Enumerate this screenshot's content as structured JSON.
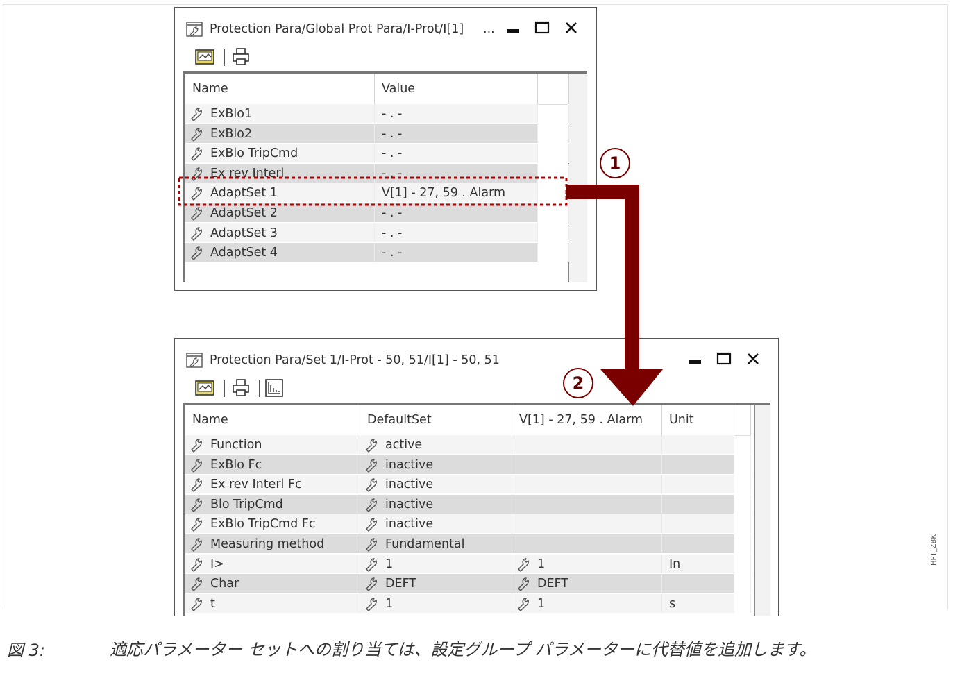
{
  "window1": {
    "title": "Protection Para/Global Prot Para/I-Prot/I[1]",
    "ellipsis": "...",
    "columns": [
      "Name",
      "Value"
    ],
    "rows": [
      {
        "name": "ExBlo1",
        "value": "- . -"
      },
      {
        "name": "ExBlo2",
        "value": "- . -"
      },
      {
        "name": "ExBlo TripCmd",
        "value": "- . -"
      },
      {
        "name": "Ex rev Interl",
        "value": "- . -"
      },
      {
        "name": "AdaptSet 1",
        "value": "V[1] - 27, 59 . Alarm"
      },
      {
        "name": "AdaptSet 2",
        "value": "- . -"
      },
      {
        "name": "AdaptSet 3",
        "value": "- . -"
      },
      {
        "name": "AdaptSet 4",
        "value": "- . -"
      }
    ]
  },
  "window2": {
    "title": "Protection Para/Set 1/I-Prot - 50, 51/I[1] - 50, 51",
    "columns": [
      "Name",
      "DefaultSet",
      "V[1] - 27, 59 . Alarm",
      "Unit"
    ],
    "rows": [
      {
        "name": "Function",
        "default": "active",
        "adapt": "",
        "unit": ""
      },
      {
        "name": "ExBlo Fc",
        "default": "inactive",
        "adapt": "",
        "unit": ""
      },
      {
        "name": "Ex rev Interl Fc",
        "default": "inactive",
        "adapt": "",
        "unit": ""
      },
      {
        "name": "Blo TripCmd",
        "default": "inactive",
        "adapt": "",
        "unit": ""
      },
      {
        "name": "ExBlo TripCmd Fc",
        "default": "inactive",
        "adapt": "",
        "unit": ""
      },
      {
        "name": "Measuring method",
        "default": "Fundamental",
        "adapt": "",
        "unit": ""
      },
      {
        "name": "I>",
        "default": "1",
        "adapt": "1",
        "unit": "In"
      },
      {
        "name": "Char",
        "default": "DEFT",
        "adapt": "DEFT",
        "unit": ""
      },
      {
        "name": "t",
        "default": "1",
        "adapt": "1",
        "unit": "s"
      }
    ]
  },
  "callouts": {
    "one": "1",
    "two": "2"
  },
  "caption": {
    "label": "図 3:",
    "text": "適応パラメーター セットへの割り当ては、設定グループ パラメーターに代替値を追加します。"
  },
  "side_code": "HPT_ZBK",
  "colors": {
    "arrow": "#7a0000",
    "highlight_border": "#b00000",
    "row_light": "#f4f4f4",
    "row_dark": "#dcdcdc"
  },
  "icons": {
    "parameter": "wrench-icon",
    "window": "parameter-window-icon",
    "save": "save-to-device-icon",
    "print": "print-icon",
    "chart": "chart-icon"
  }
}
